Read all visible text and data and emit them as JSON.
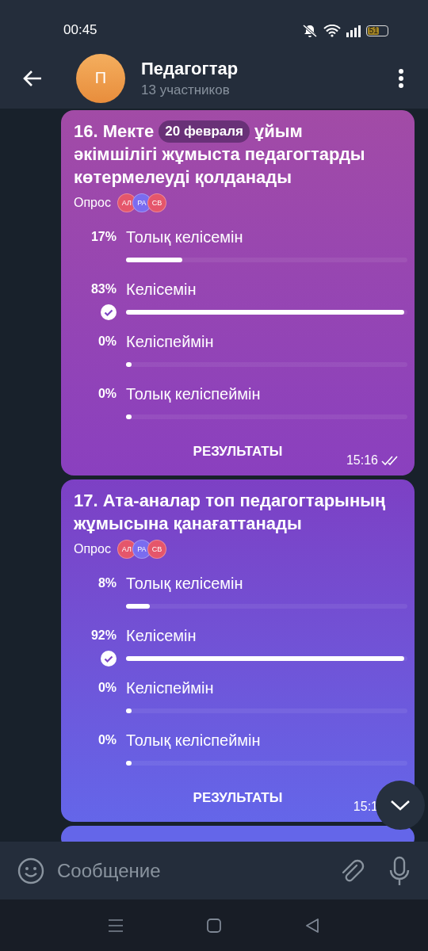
{
  "status_bar": {
    "time": "00:45",
    "battery": "51"
  },
  "header": {
    "avatar_letter": "П",
    "title": "Педагогтар",
    "subtitle": "13 участников"
  },
  "date_badge": "20 февраля",
  "messages": [
    {
      "title_parts": [
        "16. Мекте",
        "ұйым",
        "әкімшілігі жұмыста педагогтарды көтермелеуді қолданады"
      ],
      "poll_label": "Опрос",
      "voters": [
        {
          "initials": "АЛ",
          "color": "#e5566b"
        },
        {
          "initials": "РА",
          "color": "#7a6cf0"
        },
        {
          "initials": "СВ",
          "color": "#e5566b"
        }
      ],
      "options": [
        {
          "percent": "17%",
          "label": "Толық келісемін",
          "level": 0.2,
          "selected": false
        },
        {
          "percent": "83%",
          "label": "Келісемін",
          "level": 0.99,
          "selected": true
        },
        {
          "percent": "0%",
          "label": "Келіспеймін",
          "level": 0.02,
          "selected": false
        },
        {
          "percent": "0%",
          "label": "Толық келіспеймін",
          "level": 0.02,
          "selected": false
        }
      ],
      "results": "РЕЗУЛЬТАТЫ",
      "time": "15:16",
      "read": true
    },
    {
      "title_parts": [
        "17. Ата-аналар топ педагогтарының жұмысына қанағаттанады"
      ],
      "poll_label": "Опрос",
      "voters": [
        {
          "initials": "АЛ",
          "color": "#e5566b"
        },
        {
          "initials": "РА",
          "color": "#7a6cf0"
        },
        {
          "initials": "СВ",
          "color": "#e5566b"
        }
      ],
      "options": [
        {
          "percent": "8%",
          "label": "Толық келісемін",
          "level": 0.085,
          "selected": false
        },
        {
          "percent": "92%",
          "label": "Келісемін",
          "level": 0.99,
          "selected": true
        },
        {
          "percent": "0%",
          "label": "Келіспеймін",
          "level": 0.02,
          "selected": false
        },
        {
          "percent": "0%",
          "label": "Толық келіспеймін",
          "level": 0.02,
          "selected": false
        }
      ],
      "results": "РЕЗУЛЬТАТЫ",
      "time": "15:1"
    }
  ],
  "input": {
    "placeholder": "Сообщение"
  }
}
